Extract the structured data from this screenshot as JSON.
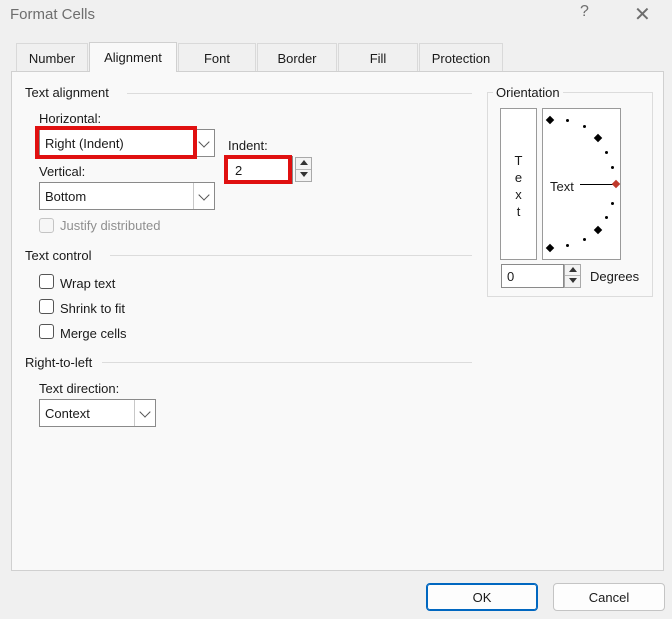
{
  "window": {
    "title": "Format Cells",
    "help": "?",
    "close": "✕"
  },
  "tabs": [
    "Number",
    "Alignment",
    "Font",
    "Border",
    "Fill",
    "Protection"
  ],
  "text_alignment": {
    "group_label": "Text alignment",
    "horizontal_label": "Horizontal:",
    "horizontal_value": "Right (Indent)",
    "vertical_label": "Vertical:",
    "vertical_value": "Bottom",
    "indent_label": "Indent:",
    "indent_value": "2",
    "justify_distributed": "Justify distributed"
  },
  "text_control": {
    "group_label": "Text control",
    "wrap_text": "Wrap text",
    "shrink_to_fit": "Shrink to fit",
    "merge_cells": "Merge cells"
  },
  "right_to_left": {
    "group_label": "Right-to-left",
    "text_direction_label": "Text direction:",
    "text_direction_value": "Context"
  },
  "orientation": {
    "group_label": "Orientation",
    "vertical_text": [
      "T",
      "e",
      "x",
      "t"
    ],
    "dial_text": "Text",
    "degrees_value": "0",
    "degrees_label": "Degrees"
  },
  "buttons": {
    "ok": "OK",
    "cancel": "Cancel"
  },
  "colors": {
    "highlight": "#e01010",
    "accent": "#0067c0",
    "dial_marker": "#c0392b"
  }
}
